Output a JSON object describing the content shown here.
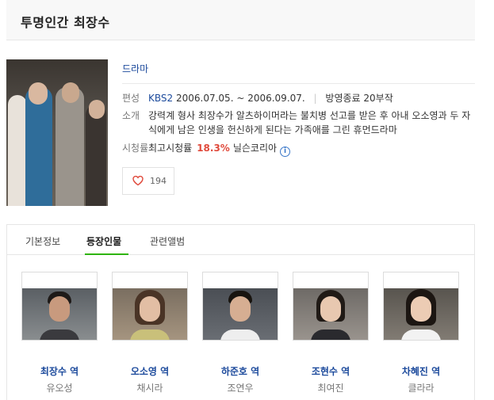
{
  "title": "투명인간 최장수",
  "genre": "드라마",
  "info": {
    "broadcast_label": "편성",
    "channel": "KBS2",
    "period": "2006.07.05. ~ 2006.09.07.",
    "status": "방영종료 20부작",
    "summary_label": "소개",
    "summary": "강력계 형사 최장수가 알츠하이머라는 불치병 선고를 받은 후 아내 오소영과 두 자식에게 남은 인생을 헌신하게 된다는 가족애를 그린 휴먼드라마",
    "rating_label": "시청률",
    "rating_prefix": "최고시청률",
    "rating_value": "18.3%",
    "rating_source": "닐슨코리아"
  },
  "like": {
    "count": "194",
    "icon": "heart-icon"
  },
  "tabs": [
    {
      "label": "기본정보",
      "active": false
    },
    {
      "label": "등장인물",
      "active": true
    },
    {
      "label": "관련앨범",
      "active": false
    }
  ],
  "cast": [
    {
      "role": "최장수 역",
      "actor": "유오성"
    },
    {
      "role": "오소영 역",
      "actor": "채시라"
    },
    {
      "role": "하준호 역",
      "actor": "조연우"
    },
    {
      "role": "조현수 역",
      "actor": "최여진"
    },
    {
      "role": "차혜진 역",
      "actor": "클라라"
    }
  ],
  "colors": {
    "link": "#1c4a9c",
    "rating": "#e04a3c",
    "active_tab": "#2eb400"
  }
}
